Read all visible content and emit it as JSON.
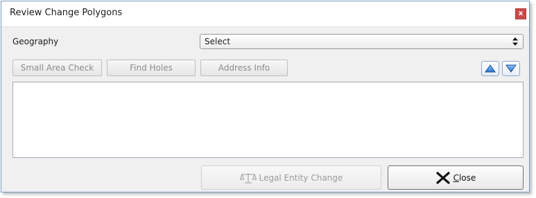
{
  "window": {
    "title": "Review Change Polygons",
    "close_glyph": "x"
  },
  "geography": {
    "label": "Geography",
    "selected": "Select"
  },
  "toolbar": {
    "small_area_check": "Small Area Check",
    "find_holes": "Find Holes",
    "address_info": "Address Info",
    "move_up_icon": "triangle-up-icon",
    "move_down_icon": "triangle-down-icon"
  },
  "results": {
    "text": ""
  },
  "footer": {
    "legal_entity_change": "Legal Entity Change",
    "legal_icon": "scales-icon",
    "close_accel": "C",
    "close_rest": "lose",
    "close_icon": "x-mark-icon"
  },
  "colors": {
    "title_close_bg": "#c94a4a",
    "arrow_blue": "#3a86d8",
    "disabled_text": "#8c8c8c"
  }
}
